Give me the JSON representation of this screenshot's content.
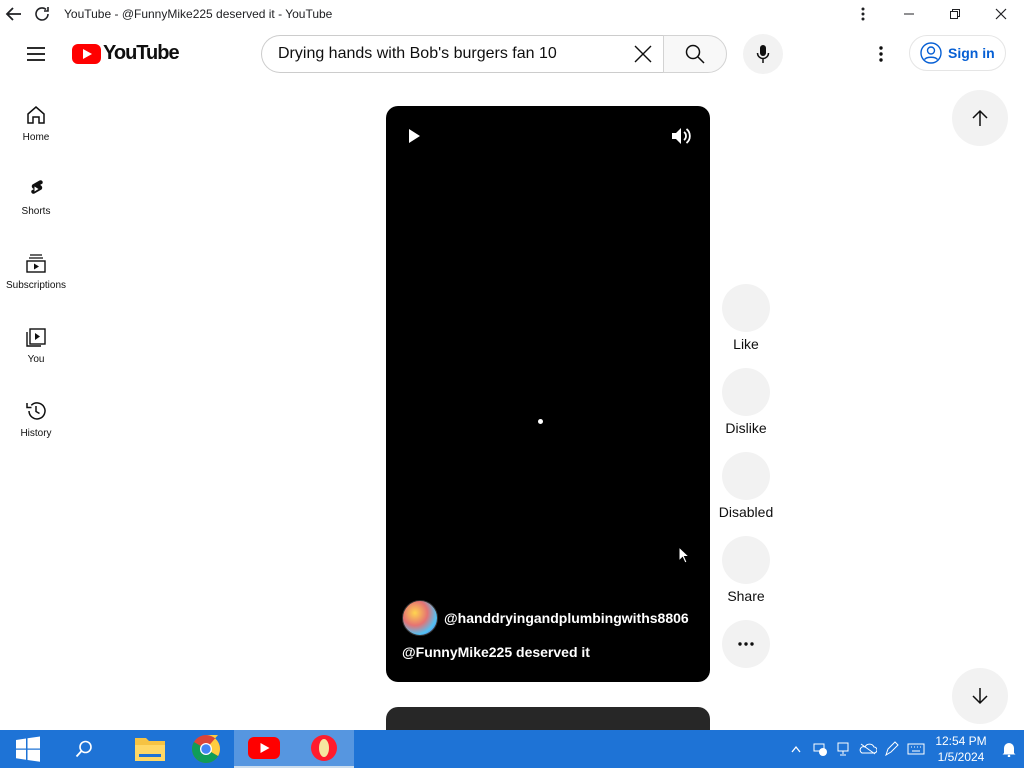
{
  "window": {
    "title": "YouTube - @FunnyMike225 deserved it - YouTube"
  },
  "masthead": {
    "logo_text": "YouTube",
    "search_value": "Drying hands with Bob's burgers fan 10",
    "signin_label": "Sign in"
  },
  "guide": {
    "items": [
      {
        "label": "Home",
        "icon": "home-icon"
      },
      {
        "label": "Shorts",
        "icon": "shorts-icon"
      },
      {
        "label": "Subscriptions",
        "icon": "subscriptions-icon"
      },
      {
        "label": "You",
        "icon": "you-icon"
      },
      {
        "label": "History",
        "icon": "history-icon"
      }
    ]
  },
  "short": {
    "channel_handle": "@handdryingandplumbingwiths8806",
    "caption": "@FunnyMike225 deserved it"
  },
  "actions": {
    "like": "Like",
    "dislike": "Dislike",
    "comments": "Disabled",
    "share": "Share"
  },
  "taskbar": {
    "time": "12:54 PM",
    "date": "1/5/2024"
  },
  "colors": {
    "brand_red": "#ff0000",
    "link_blue": "#065fd4",
    "taskbar_blue": "#1e73d6"
  }
}
